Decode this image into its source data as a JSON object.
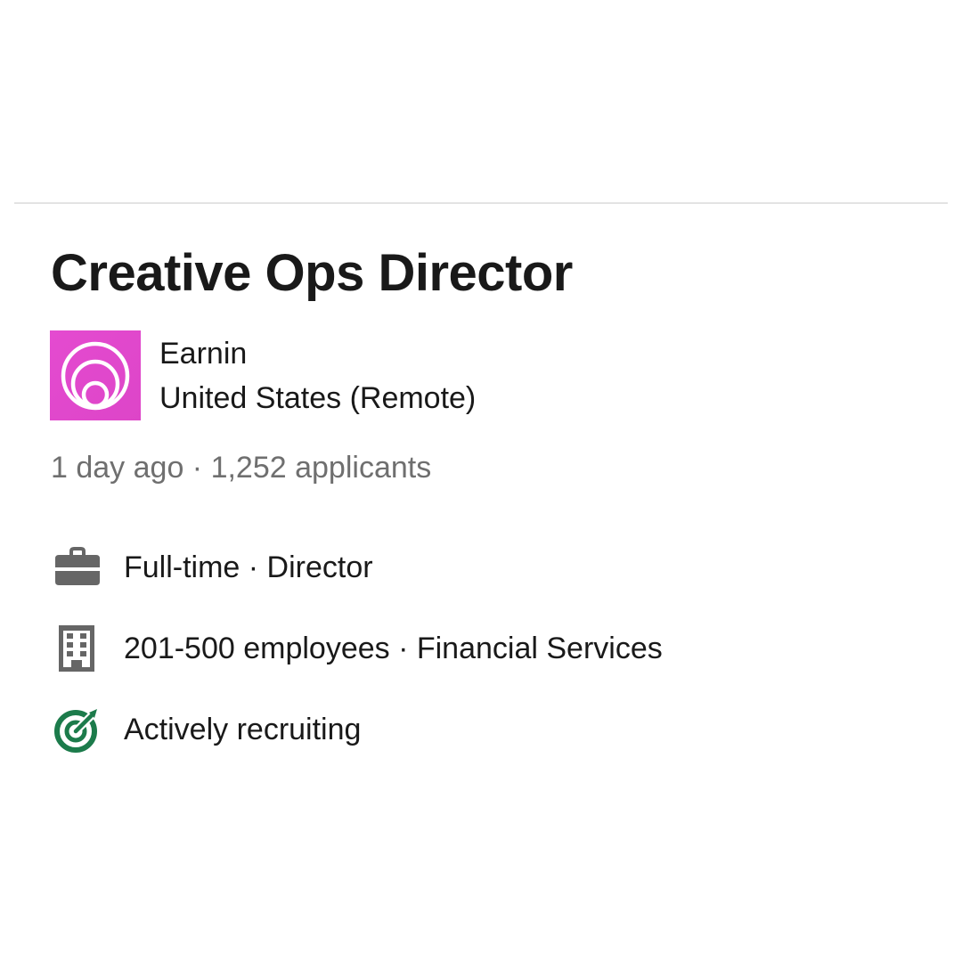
{
  "job": {
    "title": "Creative Ops Director",
    "company": {
      "name": "Earnin",
      "location": "United States (Remote)",
      "logo_icon": "earnin-logo-icon",
      "logo_color": "#e44bd0"
    },
    "meta": {
      "posted": "1 day ago",
      "separator": " · ",
      "applicants": "1,252 applicants"
    },
    "insights": [
      {
        "icon": "briefcase-icon",
        "text": "Full-time · Director",
        "icon_color": "#666666"
      },
      {
        "icon": "building-icon",
        "text": "201-500 employees · Financial Services",
        "icon_color": "#666666"
      },
      {
        "icon": "target-icon",
        "text": "Actively recruiting",
        "icon_color": "#1c7b4b"
      }
    ]
  }
}
